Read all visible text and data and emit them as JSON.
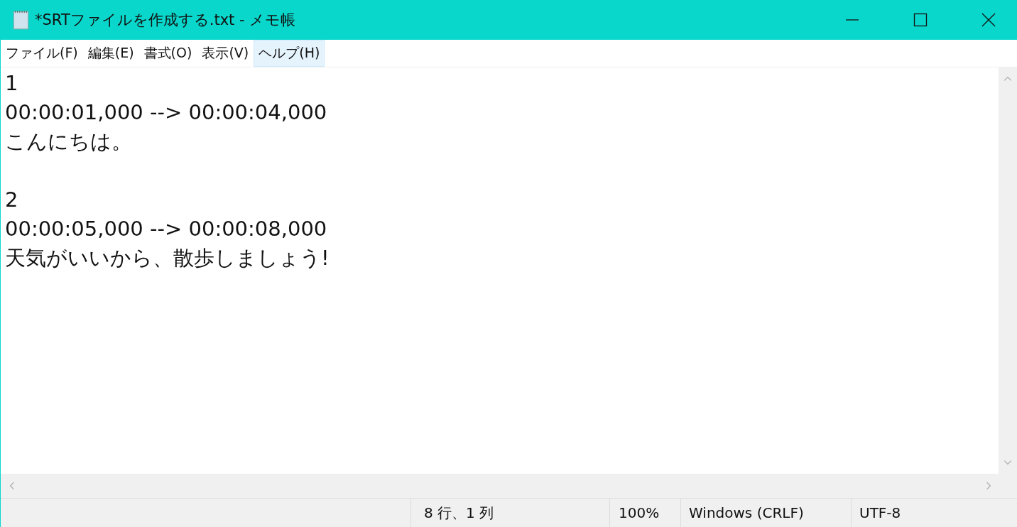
{
  "window": {
    "title": "*SRTファイルを作成する.txt - メモ帳"
  },
  "menu": [
    {
      "label": "ファイル(F)",
      "selected": false
    },
    {
      "label": "編集(E)",
      "selected": false
    },
    {
      "label": "書式(O)",
      "selected": false
    },
    {
      "label": "表示(V)",
      "selected": false
    },
    {
      "label": "ヘルプ(H)",
      "selected": true
    }
  ],
  "editor": {
    "blocks": [
      [
        "1",
        "00:00:01,000 --> 00:00:04,000",
        "こんにちは。"
      ],
      [
        "2",
        "00:00:05,000 --> 00:00:08,000",
        "天気がいいから、散歩しましょう!"
      ]
    ]
  },
  "status_bar": {
    "position": "8 行、1 列",
    "zoom": "100%",
    "line_ending": "Windows (CRLF)",
    "encoding": "UTF-8"
  }
}
